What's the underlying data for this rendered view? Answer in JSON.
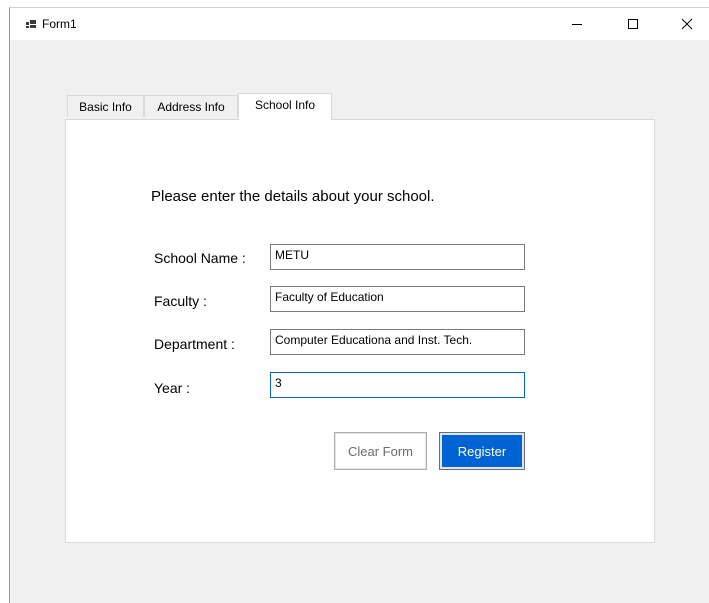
{
  "window": {
    "title": "Form1",
    "icon": "app-window-icon",
    "controls": {
      "minimize_icon": "minimize-icon",
      "maximize_icon": "maximize-icon",
      "close_icon": "close-icon"
    }
  },
  "tabs": [
    {
      "label": "Basic Info",
      "active": false
    },
    {
      "label": "Address Info",
      "active": false
    },
    {
      "label": "School Info",
      "active": true
    }
  ],
  "school_info": {
    "heading": "Please enter the details about your school.",
    "fields": [
      {
        "label": "School Name :",
        "value": "METU"
      },
      {
        "label": "Faculty :",
        "value": "Faculty of Education"
      },
      {
        "label": "Department :",
        "value": "Computer Educationa and Inst. Tech."
      },
      {
        "label": "Year :",
        "value": "3"
      }
    ],
    "buttons": {
      "clear_label": "Clear Form",
      "register_label": "Register"
    }
  },
  "colors": {
    "accent": "#0063d3",
    "focus_border": "#0a64c8",
    "window_bg": "#f0f0f0"
  }
}
